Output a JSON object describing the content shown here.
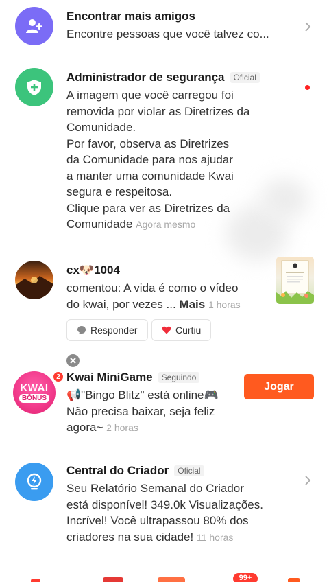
{
  "items": [
    {
      "id": "find_friends",
      "title": "Encontrar mais amigos",
      "body": "Encontre pessoas que você talvez co...",
      "icon": "add-friends-icon",
      "color": "#7b6cf6"
    },
    {
      "id": "security_admin",
      "title": "Administrador de segurança",
      "tag": "Oficial",
      "lines": [
        "A imagem que você carregou foi",
        "removida por violar as Diretrizes da",
        "Comunidade.",
        "Por favor, observa as Diretrizes",
        "da Comunidade para nos ajudar",
        "a manter uma comunidade Kwai",
        "segura e respeitosa.",
        "Clique para ver as Diretrizes da",
        "Comunidade"
      ],
      "time": "Agora mesmo",
      "icon": "shield-plus-icon",
      "color": "#3cc47c"
    },
    {
      "id": "comment",
      "title": "cx🐶1004",
      "lines": [
        "comentou: A vida é como  o vídeo",
        "do kwai, por vezes ..."
      ],
      "more": "Mais",
      "time": "1 horas",
      "reply_label": "Responder",
      "like_label": "Curtiu"
    },
    {
      "id": "minigame",
      "title": "Kwai MiniGame",
      "tag": "Seguindo",
      "lines": [
        "📢\"Bingo Blitz\" está online🎮",
        "Não precisa baixar, seja feliz",
        "agora~"
      ],
      "time": "2 horas",
      "action_label": "Jogar",
      "avatar_text": [
        "KWAI",
        "BÔNUS"
      ],
      "badge": "2"
    },
    {
      "id": "creator_center",
      "title": "Central do Criador",
      "tag": "Oficial",
      "lines": [
        "Seu Relatório Semanal do Criador",
        "está disponível! 349.0k Visualizações.",
        "Incrível! Você ultrapassou 80% dos",
        "criadores na sua cidade!"
      ],
      "time": "11 horas",
      "icon": "lightning-icon",
      "color": "#3a9cf0"
    }
  ],
  "bottom_badge": "99+"
}
